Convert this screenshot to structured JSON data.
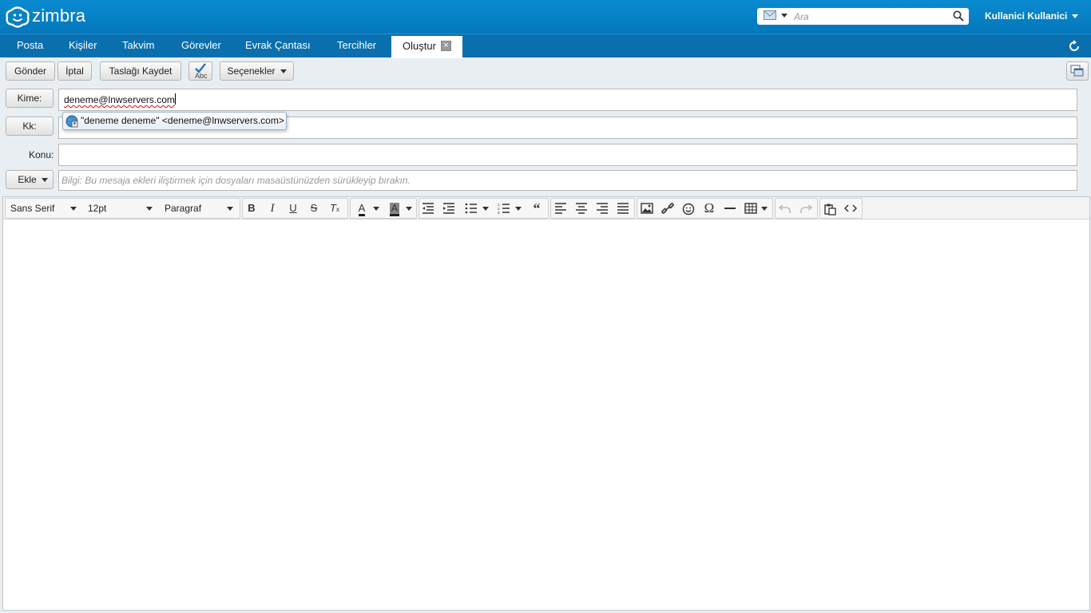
{
  "header": {
    "logo_text": "zimbra",
    "search_placeholder": "Ara",
    "user_name": "Kullanici Kullanici"
  },
  "nav": {
    "tabs": [
      {
        "label": "Posta"
      },
      {
        "label": "Kişiler"
      },
      {
        "label": "Takvim"
      },
      {
        "label": "Görevler"
      },
      {
        "label": "Evrak Çantası"
      },
      {
        "label": "Tercihler"
      },
      {
        "label": "Oluştur"
      }
    ]
  },
  "toolbar": {
    "send": "Gönder",
    "cancel": "İptal",
    "save_draft": "Taslağı Kaydet",
    "spell": "Abc",
    "options": "Seçenekler"
  },
  "compose": {
    "to_label": "Kime:",
    "to_value": "deneme@lnwservers.com",
    "cc_label": "Kk:",
    "subject_label": "Konu:",
    "attach_label": "Ekle",
    "attach_hint": "Bilgi: Bu mesaja ekleri iliştirmek için dosyaları masaüstünüzden sürükleyip bırakın.",
    "autocomplete": "\"deneme deneme\" <deneme@lnwservers.com>"
  },
  "editor": {
    "font_family": "Sans Serif",
    "font_size": "12pt",
    "block_format": "Paragraf",
    "text_color_glyph": "A",
    "bg_color_glyph": "A"
  }
}
